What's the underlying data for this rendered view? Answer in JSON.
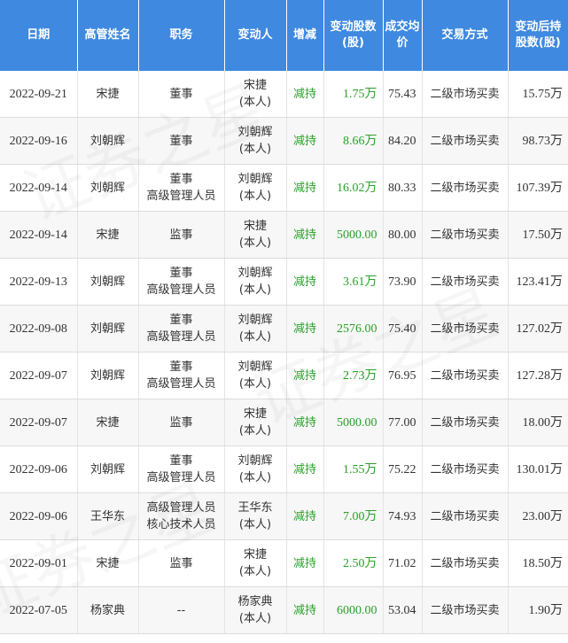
{
  "headers": [
    "日期",
    "高管姓名",
    "职务",
    "变动人",
    "增减",
    "变动股数(股)",
    "成交均价",
    "交易方式",
    "变动后持股数(股)"
  ],
  "rows": [
    {
      "date": "2022-09-21",
      "name": "宋捷",
      "position": "董事",
      "changer": "宋捷\n(本人)",
      "direction": "减持",
      "shares": "1.75万",
      "price": "75.43",
      "method": "二级市场买卖",
      "after": "15.75万"
    },
    {
      "date": "2022-09-16",
      "name": "刘朝辉",
      "position": "董事",
      "changer": "刘朝辉\n(本人)",
      "direction": "减持",
      "shares": "8.66万",
      "price": "84.20",
      "method": "二级市场买卖",
      "after": "98.73万"
    },
    {
      "date": "2022-09-14",
      "name": "刘朝辉",
      "position": "董事\n高级管理人员",
      "changer": "刘朝辉\n(本人)",
      "direction": "减持",
      "shares": "16.02万",
      "price": "80.33",
      "method": "二级市场买卖",
      "after": "107.39万"
    },
    {
      "date": "2022-09-14",
      "name": "宋捷",
      "position": "监事",
      "changer": "宋捷\n(本人)",
      "direction": "减持",
      "shares": "5000.00",
      "price": "80.00",
      "method": "二级市场买卖",
      "after": "17.50万"
    },
    {
      "date": "2022-09-13",
      "name": "刘朝辉",
      "position": "董事\n高级管理人员",
      "changer": "刘朝辉\n(本人)",
      "direction": "减持",
      "shares": "3.61万",
      "price": "73.90",
      "method": "二级市场买卖",
      "after": "123.41万"
    },
    {
      "date": "2022-09-08",
      "name": "刘朝辉",
      "position": "董事\n高级管理人员",
      "changer": "刘朝辉\n(本人)",
      "direction": "减持",
      "shares": "2576.00",
      "price": "75.40",
      "method": "二级市场买卖",
      "after": "127.02万"
    },
    {
      "date": "2022-09-07",
      "name": "刘朝辉",
      "position": "董事\n高级管理人员",
      "changer": "刘朝辉\n(本人)",
      "direction": "减持",
      "shares": "2.73万",
      "price": "76.95",
      "method": "二级市场买卖",
      "after": "127.28万"
    },
    {
      "date": "2022-09-07",
      "name": "宋捷",
      "position": "监事",
      "changer": "宋捷\n(本人)",
      "direction": "减持",
      "shares": "5000.00",
      "price": "77.00",
      "method": "二级市场买卖",
      "after": "18.00万"
    },
    {
      "date": "2022-09-06",
      "name": "刘朝辉",
      "position": "董事\n高级管理人员",
      "changer": "刘朝辉\n(本人)",
      "direction": "减持",
      "shares": "1.55万",
      "price": "75.22",
      "method": "二级市场买卖",
      "after": "130.01万"
    },
    {
      "date": "2022-09-06",
      "name": "王华东",
      "position": "高级管理人员\n核心技术人员",
      "changer": "王华东\n(本人)",
      "direction": "减持",
      "shares": "7.00万",
      "price": "74.93",
      "method": "二级市场买卖",
      "after": "23.00万"
    },
    {
      "date": "2022-09-01",
      "name": "宋捷",
      "position": "监事",
      "changer": "宋捷\n(本人)",
      "direction": "减持",
      "shares": "2.50万",
      "price": "71.02",
      "method": "二级市场买卖",
      "after": "18.50万"
    },
    {
      "date": "2022-07-05",
      "name": "杨家典",
      "position": "--",
      "changer": "杨家典\n(本人)",
      "direction": "减持",
      "shares": "6000.00",
      "price": "53.04",
      "method": "二级市场买卖",
      "after": "1.90万"
    }
  ],
  "watermark": "证券之星",
  "colors": {
    "header_bg": "#3f89e0",
    "reduce_green": "#2aa02a"
  }
}
